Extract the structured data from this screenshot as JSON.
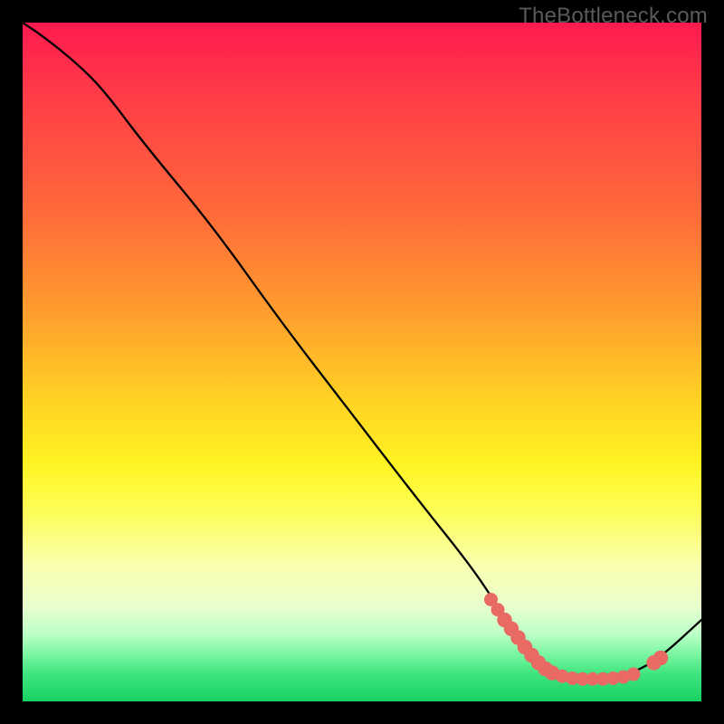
{
  "watermark": "TheBottleneck.com",
  "colors": {
    "gradient_top": "#ff1a4f",
    "gradient_mid": "#fff322",
    "gradient_bottom": "#18d163",
    "curve": "#000000",
    "marker": "#e96a62",
    "frame": "#000000"
  },
  "chart_data": {
    "type": "line",
    "title": "",
    "xlabel": "",
    "ylabel": "",
    "xlim": [
      0,
      100
    ],
    "ylim": [
      0,
      100
    ],
    "grid": false,
    "curve": [
      {
        "x": 0,
        "y": 100
      },
      {
        "x": 3,
        "y": 98
      },
      {
        "x": 8,
        "y": 94
      },
      {
        "x": 12,
        "y": 90
      },
      {
        "x": 18,
        "y": 82
      },
      {
        "x": 28,
        "y": 70
      },
      {
        "x": 38,
        "y": 56
      },
      {
        "x": 48,
        "y": 43
      },
      {
        "x": 58,
        "y": 30
      },
      {
        "x": 66,
        "y": 20
      },
      {
        "x": 70,
        "y": 14
      },
      {
        "x": 74,
        "y": 8
      },
      {
        "x": 78,
        "y": 4.2
      },
      {
        "x": 82,
        "y": 3.3
      },
      {
        "x": 86,
        "y": 3.3
      },
      {
        "x": 90,
        "y": 4.2
      },
      {
        "x": 94,
        "y": 6.5
      },
      {
        "x": 100,
        "y": 12
      }
    ],
    "markers": [
      {
        "x": 69,
        "y": 15.0,
        "r": 1.0
      },
      {
        "x": 70,
        "y": 13.5,
        "r": 1.0
      },
      {
        "x": 71,
        "y": 12.0,
        "r": 1.1
      },
      {
        "x": 72,
        "y": 10.7,
        "r": 1.1
      },
      {
        "x": 73,
        "y": 9.4,
        "r": 1.1
      },
      {
        "x": 74,
        "y": 8.0,
        "r": 1.1
      },
      {
        "x": 75,
        "y": 6.8,
        "r": 1.1
      },
      {
        "x": 76,
        "y": 5.7,
        "r": 1.1
      },
      {
        "x": 77,
        "y": 4.8,
        "r": 1.1
      },
      {
        "x": 78,
        "y": 4.2,
        "r": 1.1
      },
      {
        "x": 79.5,
        "y": 3.7,
        "r": 1.0
      },
      {
        "x": 81,
        "y": 3.4,
        "r": 1.0
      },
      {
        "x": 82.5,
        "y": 3.3,
        "r": 1.0
      },
      {
        "x": 84,
        "y": 3.3,
        "r": 1.0
      },
      {
        "x": 85.5,
        "y": 3.3,
        "r": 1.0
      },
      {
        "x": 87,
        "y": 3.4,
        "r": 1.0
      },
      {
        "x": 88.5,
        "y": 3.6,
        "r": 1.0
      },
      {
        "x": 90,
        "y": 4.0,
        "r": 1.0
      },
      {
        "x": 93,
        "y": 5.7,
        "r": 1.1
      },
      {
        "x": 94,
        "y": 6.4,
        "r": 1.1
      }
    ]
  }
}
